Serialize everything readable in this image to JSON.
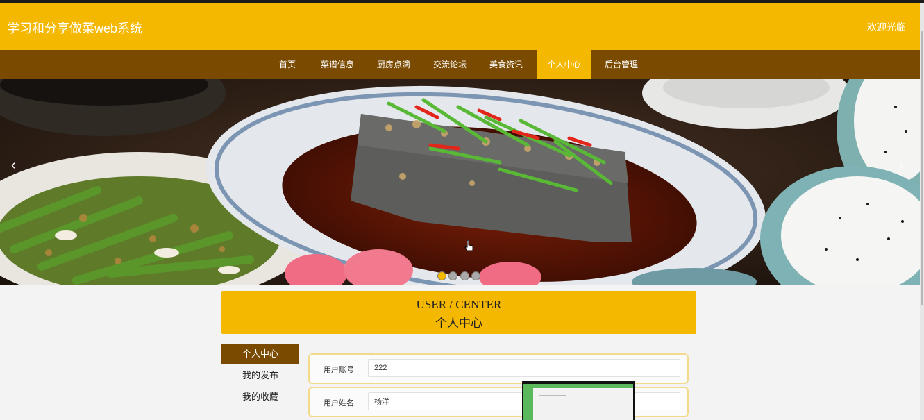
{
  "header": {
    "site_title": "学习和分享做菜web系统",
    "welcome": "欢迎光临"
  },
  "nav": {
    "items": [
      {
        "label": "首页"
      },
      {
        "label": "菜谱信息"
      },
      {
        "label": "厨房点滴"
      },
      {
        "label": "交流论坛"
      },
      {
        "label": "美食资讯"
      },
      {
        "label": "个人中心",
        "active": true
      },
      {
        "label": "后台管理"
      }
    ]
  },
  "banner": {
    "prev_icon": "chevron-left-icon",
    "next_icon": "chevron-right-icon",
    "slide_count": 4,
    "active_slide": 1
  },
  "user_center": {
    "title_en": "USER / CENTER",
    "title_cn": "个人中心"
  },
  "sidebar": {
    "items": [
      {
        "label": "个人中心",
        "active": true
      },
      {
        "label": "我的发布"
      },
      {
        "label": "我的收藏"
      }
    ]
  },
  "form": {
    "fields": [
      {
        "label": "用户账号",
        "value": "222"
      },
      {
        "label": "用户姓名",
        "value": "杨洋"
      }
    ]
  },
  "colors": {
    "brand_yellow": "#f4b800",
    "nav_brown": "#7a4a00"
  }
}
